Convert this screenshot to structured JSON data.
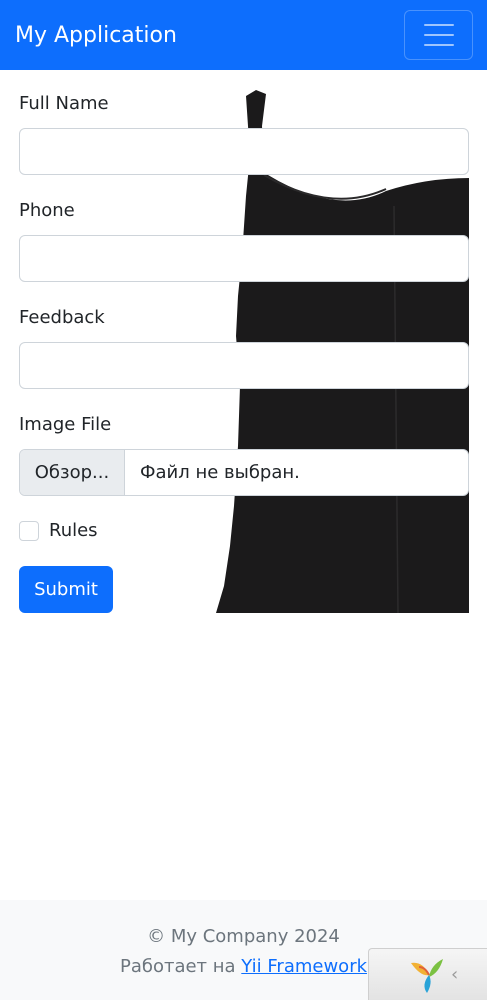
{
  "navbar": {
    "brand": "My Application",
    "toggler_icon": "hamburger-icon"
  },
  "form": {
    "fields": [
      {
        "label": "Full Name",
        "value": ""
      },
      {
        "label": "Phone",
        "value": ""
      },
      {
        "label": "Feedback",
        "value": ""
      }
    ],
    "image_file": {
      "label": "Image File",
      "browse_label": "Обзор...",
      "no_file_text": "Файл не выбран."
    },
    "rules": {
      "label": "Rules",
      "checked": false
    },
    "submit_label": "Submit"
  },
  "footer": {
    "copyright": "© My Company 2024",
    "powered_prefix": "Работает на ",
    "powered_link": "Yii Framework"
  },
  "debug_toolbar": {
    "logo_icon": "yii-logo-icon",
    "collapse_icon": "chevron-left-icon",
    "collapse_glyph": "‹"
  },
  "colors": {
    "primary": "#0d6efd",
    "footer_bg": "#f8f9fa",
    "muted_text": "#6c757d"
  }
}
